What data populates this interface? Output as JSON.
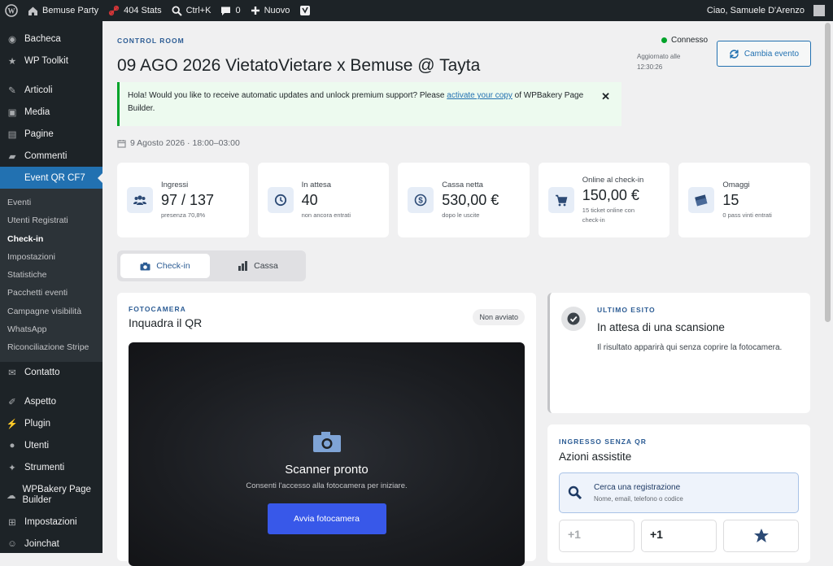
{
  "adminbar": {
    "site_name": "Bemuse Party",
    "stats_404": "404 Stats",
    "search_shortcut": "Ctrl+K",
    "comments_count": "0",
    "new_label": "Nuovo",
    "greeting": "Ciao, Samuele D'Arenzo"
  },
  "sidebar": {
    "top": [
      "Bacheca",
      "WP Toolkit"
    ],
    "group1": [
      "Articoli",
      "Media",
      "Pagine",
      "Commenti"
    ],
    "active": "Event QR CF7",
    "submenu": [
      "Eventi",
      "Utenti Registrati",
      "Check-in",
      "Impostazioni",
      "Statistiche",
      "Pacchetti eventi",
      "Campagne visibilità",
      "WhatsApp",
      "Riconciliazione Stripe"
    ],
    "contact": "Contatto",
    "group2": [
      "Aspetto",
      "Plugin",
      "Utenti",
      "Strumenti"
    ],
    "wpbakery": "WPBakery Page Builder",
    "settings": "Impostazioni",
    "joinchat": "Joinchat"
  },
  "header": {
    "eyebrow": "CONTROL ROOM",
    "title": "09 AGO 2026 VietatoVietare x Bemuse @ Tayta",
    "status": "Connesso",
    "updated_label": "Aggiornato alle",
    "updated_time": "12:30:26",
    "change_button": "Cambia evento"
  },
  "notice": {
    "text_before": "Hola! Would you like to receive automatic updates and unlock premium support? Please ",
    "link": "activate your copy",
    "text_after": " of WPBakery Page Builder.",
    "close": "✕"
  },
  "event_date": "9 Agosto 2026 · 18:00–03:00",
  "stats": [
    {
      "label": "Ingressi",
      "value": "97 / 137",
      "sub": "presenza 70,8%",
      "icon": "users-icon"
    },
    {
      "label": "In attesa",
      "value": "40",
      "sub": "non ancora entrati",
      "icon": "clock-icon"
    },
    {
      "label": "Cassa netta",
      "value": "530,00 €",
      "sub": "dopo le uscite",
      "icon": "dollar-icon"
    },
    {
      "label": "Online al check-in",
      "value": "150,00 €",
      "sub": "15 ticket online con check-in",
      "icon": "cart-icon"
    },
    {
      "label": "Omaggi",
      "value": "15",
      "sub": "0 pass vinti entrati",
      "icon": "tickets-icon"
    }
  ],
  "tabs": [
    {
      "label": "Check-in",
      "icon": "camera-icon",
      "active": true
    },
    {
      "label": "Cassa",
      "icon": "bar-chart-icon",
      "active": false
    }
  ],
  "camera": {
    "eyebrow": "FOTOCAMERA",
    "title": "Inquadra il QR",
    "badge": "Non avviato",
    "scanner_title": "Scanner pronto",
    "scanner_sub": "Consenti l'accesso alla fotocamera per iniziare.",
    "start_button": "Avvia fotocamera"
  },
  "result": {
    "eyebrow": "ULTIMO ESITO",
    "title": "In attesa di una scansione",
    "text": "Il risultato apparirà qui senza coprire la fotocamera."
  },
  "assist": {
    "eyebrow": "INGRESSO SENZA QR",
    "title": "Azioni assistite",
    "search_title": "Cerca una registrazione",
    "search_sub": "Nome, email, telefono o codice",
    "quick": [
      "+1",
      "+1"
    ]
  },
  "colors": {
    "accent": "#2271b1",
    "primary_button": "#3858e9",
    "success": "#00a32a"
  }
}
